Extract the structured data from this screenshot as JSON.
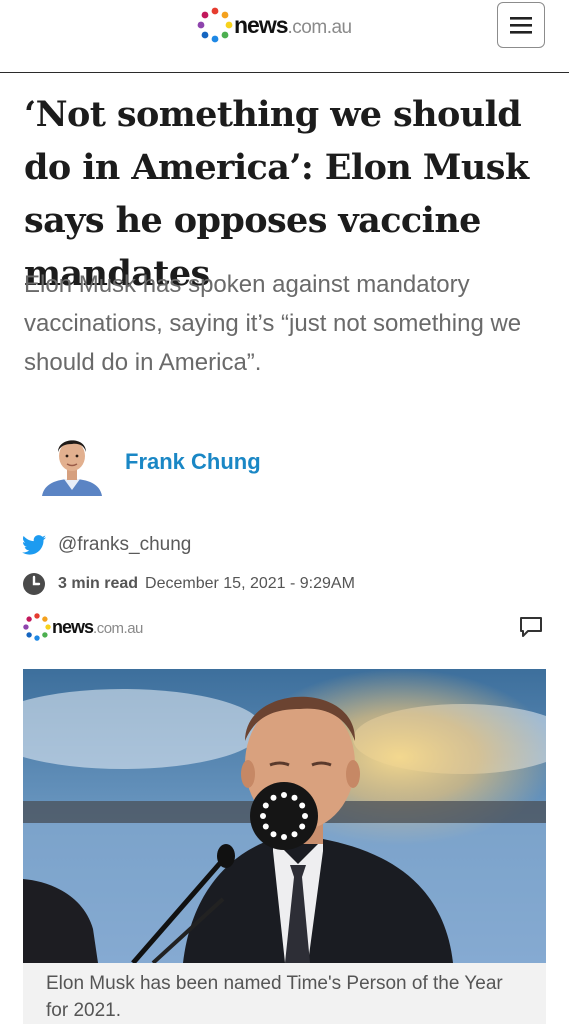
{
  "header": {
    "logo": {
      "brand": "news",
      "tld": ".com.au"
    },
    "menu_icon": "hamburger-menu-icon"
  },
  "article": {
    "headline": "‘Not something we should do in America’: Elon Musk says he opposes vaccine mandates",
    "standfirst": "Elon Musk has spoken against mandatory vaccinations, saying it’s “just not something we should do in America”.",
    "author": {
      "name": "Frank Chung",
      "twitter_handle": "@franks_chung"
    },
    "read_time": "3 min read",
    "published": "December 15, 2021 - 9:29AM",
    "source_logo": {
      "brand": "news",
      "tld": ".com.au"
    },
    "comment_icon": "comment-icon",
    "image": {
      "caption": "Elon Musk has been named Time's Person of the Year for 2021.",
      "loading_icon": "loading-spinner-icon"
    }
  },
  "colors": {
    "author_link": "#1a87c5",
    "twitter_blue": "#1d9bf0",
    "caption_bg": "#f2f2f2",
    "standfirst": "#6a6a6a"
  }
}
